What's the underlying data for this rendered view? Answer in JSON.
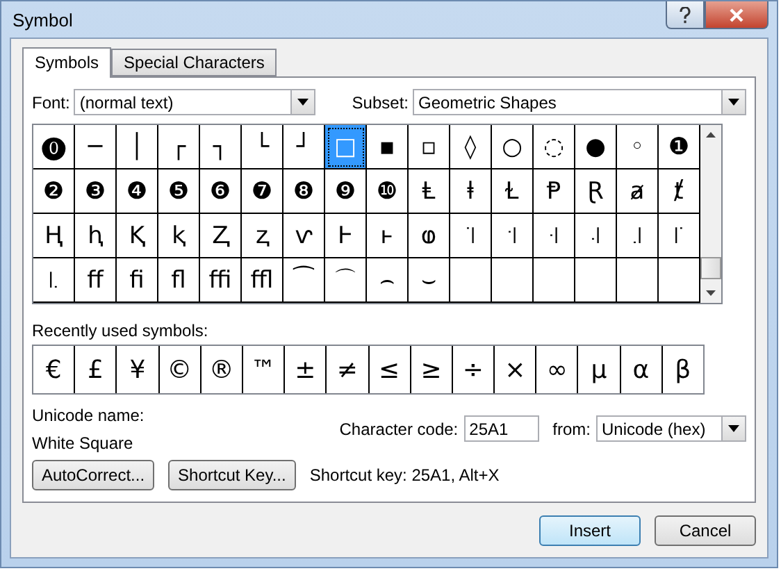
{
  "window": {
    "title": "Symbol"
  },
  "tabs": [
    {
      "label": "Symbols",
      "selected": true
    },
    {
      "label": "Special Characters",
      "selected": false
    }
  ],
  "font": {
    "label": "Font:",
    "value": "(normal text)"
  },
  "subset": {
    "label": "Subset:",
    "value": "Geometric Shapes"
  },
  "symbol_grid": {
    "rows": [
      [
        {
          "char": "⓿",
          "selected": false
        },
        {
          "char": "─",
          "selected": false
        },
        {
          "char": "│",
          "selected": false
        },
        {
          "char": "┌",
          "selected": false
        },
        {
          "char": "┐",
          "selected": false
        },
        {
          "char": "└",
          "selected": false
        },
        {
          "char": "┘",
          "selected": false
        },
        {
          "char": "□",
          "selected": true
        },
        {
          "char": "▪",
          "selected": false
        },
        {
          "char": "▫",
          "selected": false
        },
        {
          "char": "◊",
          "selected": false
        },
        {
          "char": "○",
          "selected": false
        },
        {
          "char": "◌",
          "selected": false
        },
        {
          "char": "●",
          "selected": false
        },
        {
          "char": "◦",
          "selected": false
        },
        {
          "char": "❶",
          "selected": false
        }
      ],
      [
        {
          "char": "❷",
          "selected": false
        },
        {
          "char": "❸",
          "selected": false
        },
        {
          "char": "❹",
          "selected": false
        },
        {
          "char": "❺",
          "selected": false
        },
        {
          "char": "❻",
          "selected": false
        },
        {
          "char": "❼",
          "selected": false
        },
        {
          "char": "❽",
          "selected": false
        },
        {
          "char": "❾",
          "selected": false
        },
        {
          "char": "❿",
          "selected": false
        },
        {
          "char": "Ⱡ",
          "selected": false
        },
        {
          "char": "ⱡ",
          "selected": false
        },
        {
          "char": "Ɫ",
          "selected": false
        },
        {
          "char": "Ᵽ",
          "selected": false
        },
        {
          "char": "Ɽ",
          "selected": false
        },
        {
          "char": "ⱥ",
          "selected": false
        },
        {
          "char": "ⱦ",
          "selected": false
        }
      ],
      [
        {
          "char": "Ⱨ",
          "selected": false
        },
        {
          "char": "ⱨ",
          "selected": false
        },
        {
          "char": "Ⱪ",
          "selected": false
        },
        {
          "char": "ⱪ",
          "selected": false
        },
        {
          "char": "Ⱬ",
          "selected": false
        },
        {
          "char": "ⱬ",
          "selected": false
        },
        {
          "char": "ⱱ",
          "selected": false
        },
        {
          "char": "Ⱶ",
          "selected": false
        },
        {
          "char": "ⱶ",
          "selected": false
        },
        {
          "char": "ⱷ",
          "selected": false
        },
        {
          "char": "꜈",
          "selected": false
        },
        {
          "char": "꜉",
          "selected": false
        },
        {
          "char": "꜊",
          "selected": false
        },
        {
          "char": "꜋",
          "selected": false
        },
        {
          "char": "꜌",
          "selected": false
        },
        {
          "char": "꜍",
          "selected": false
        }
      ],
      [
        {
          "char": "꜑",
          "selected": false
        },
        {
          "char": "ﬀ",
          "selected": false
        },
        {
          "char": "ﬁ",
          "selected": false
        },
        {
          "char": "ﬂ",
          "selected": false
        },
        {
          "char": "ﬃ",
          "selected": false
        },
        {
          "char": "ﬄ",
          "selected": false
        },
        {
          "char": "⁀",
          "selected": false
        },
        {
          "char": "⌒",
          "selected": false
        },
        {
          "char": "⌢",
          "selected": false
        },
        {
          "char": "⌣",
          "selected": false
        }
      ]
    ]
  },
  "recent": {
    "label": "Recently used symbols:",
    "symbols": [
      "€",
      "£",
      "¥",
      "©",
      "®",
      "™",
      "±",
      "≠",
      "≤",
      "≥",
      "÷",
      "×",
      "∞",
      "µ",
      "α",
      "β"
    ]
  },
  "unicode_name": {
    "label": "Unicode name:",
    "value": "White Square"
  },
  "character_code": {
    "label": "Character code:",
    "value": "25A1"
  },
  "from": {
    "label": "from:",
    "value": "Unicode (hex)"
  },
  "buttons": [
    {
      "label": "AutoCorrect..."
    },
    {
      "label": "Shortcut Key..."
    }
  ],
  "shortcut_text": "Shortcut key: 25A1, Alt+X",
  "footer_buttons": [
    {
      "label": "Insert",
      "default": true
    },
    {
      "label": "Cancel",
      "default": false
    }
  ]
}
